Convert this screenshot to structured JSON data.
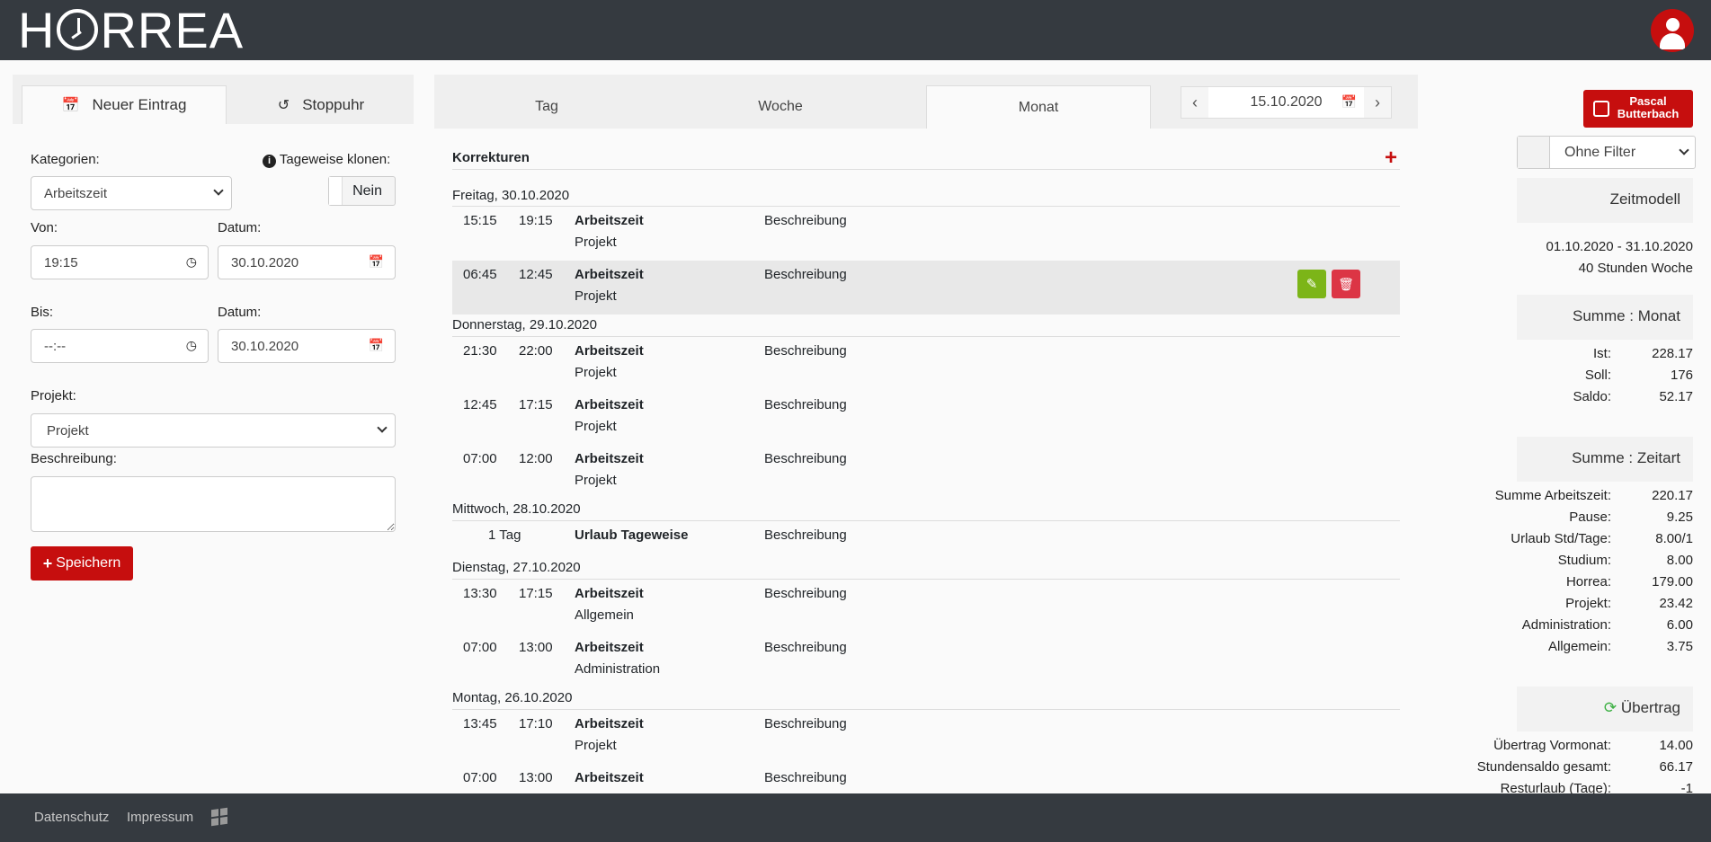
{
  "brand": {
    "logo_text": "HORREA"
  },
  "left_panel": {
    "tabs": [
      {
        "label": "Neuer Eintrag",
        "icon": "calendar-plus-icon"
      },
      {
        "label": "Stoppuhr",
        "icon": "history-icon"
      }
    ],
    "kategorien_label": "Kategorien:",
    "kategorien_value": "Arbeitszeit",
    "tageweise_label": "Tageweise klonen:",
    "tageweise_value": "Nein",
    "von_label": "Von:",
    "von_value": "19:15",
    "von_datum_label": "Datum:",
    "von_datum_value": "30.10.2020",
    "bis_label": "Bis:",
    "bis_value": "--:--",
    "bis_datum_label": "Datum:",
    "bis_datum_value": "30.10.2020",
    "projekt_label": "Projekt:",
    "projekt_value": "Projekt",
    "beschreibung_label": "Beschreibung:",
    "save_label": "Speichern"
  },
  "view_tabs": [
    "Tag",
    "Woche",
    "Monat"
  ],
  "active_view": "Monat",
  "date_nav": {
    "value": "15.10.2020"
  },
  "entries_section": {
    "title": "Korrekturen",
    "days": [
      {
        "label": "Freitag, 30.10.2020",
        "rows": [
          {
            "start": "15:15",
            "end": "19:15",
            "category": "Arbeitszeit",
            "project": "Projekt",
            "description": "Beschreibung"
          },
          {
            "start": "06:45",
            "end": "12:45",
            "category": "Arbeitszeit",
            "project": "Projekt",
            "description": "Beschreibung",
            "highlighted": true
          }
        ]
      },
      {
        "label": "Donnerstag, 29.10.2020",
        "rows": [
          {
            "start": "21:30",
            "end": "22:00",
            "category": "Arbeitszeit",
            "project": "Projekt",
            "description": "Beschreibung"
          },
          {
            "start": "12:45",
            "end": "17:15",
            "category": "Arbeitszeit",
            "project": "Projekt",
            "description": "Beschreibung"
          },
          {
            "start": "07:00",
            "end": "12:00",
            "category": "Arbeitszeit",
            "project": "Projekt",
            "description": "Beschreibung"
          }
        ]
      },
      {
        "label": "Mittwoch, 28.10.2020",
        "rows": [
          {
            "duration": "1 Tag",
            "category": "Urlaub Tageweise",
            "description": "Beschreibung"
          }
        ]
      },
      {
        "label": "Dienstag, 27.10.2020",
        "rows": [
          {
            "start": "13:30",
            "end": "17:15",
            "category": "Arbeitszeit",
            "project": "Allgemein",
            "description": "Beschreibung"
          },
          {
            "start": "07:00",
            "end": "13:00",
            "category": "Arbeitszeit",
            "project": "Administration",
            "description": "Beschreibung"
          }
        ]
      },
      {
        "label": "Montag, 26.10.2020",
        "rows": [
          {
            "start": "13:45",
            "end": "17:10",
            "category": "Arbeitszeit",
            "project": "Projekt",
            "description": "Beschreibung"
          },
          {
            "start": "07:00",
            "end": "13:00",
            "category": "Arbeitszeit",
            "project": "",
            "description": "Beschreibung"
          }
        ]
      }
    ]
  },
  "right_panel": {
    "user_first": "Pascal",
    "user_last": "Butterbach",
    "filter_value": "Ohne Filter",
    "zeitmodell_title": "Zeitmodell",
    "zeitmodell_range": "01.10.2020 - 31.10.2020",
    "zeitmodell_model": "40 Stunden Woche",
    "summe_monat_title": "Summe : Monat",
    "summe_monat": [
      {
        "label": "Ist:",
        "value": "228.17"
      },
      {
        "label": "Soll:",
        "value": "176"
      },
      {
        "label": "Saldo:",
        "value": "52.17"
      }
    ],
    "summe_zeitart_title": "Summe : Zeitart",
    "summe_zeitart": [
      {
        "label": "Summe Arbeitszeit:",
        "value": "220.17"
      },
      {
        "label": "Pause:",
        "value": "9.25"
      },
      {
        "label": "Urlaub Std/Tage:",
        "value": "8.00/1"
      },
      {
        "label": "Studium:",
        "value": "8.00"
      },
      {
        "label": "Horrea:",
        "value": "179.00"
      },
      {
        "label": "Projekt:",
        "value": "23.42"
      },
      {
        "label": "Administration:",
        "value": "6.00"
      },
      {
        "label": "Allgemein:",
        "value": "3.75"
      }
    ],
    "uebertrag_title": "Übertrag",
    "uebertrag": [
      {
        "label": "Übertrag Vormonat:",
        "value": "14.00"
      },
      {
        "label": "Stundensaldo gesamt:",
        "value": "66.17"
      },
      {
        "label": "Resturlaub (Tage):",
        "value": "-1"
      }
    ]
  },
  "footer": {
    "links": [
      "Datenschutz",
      "Impressum"
    ]
  },
  "colors": {
    "brand_red": "#c60e0e",
    "topbar": "#353a40",
    "edit_green": "#7cb518",
    "delete_red": "#dc3545"
  }
}
